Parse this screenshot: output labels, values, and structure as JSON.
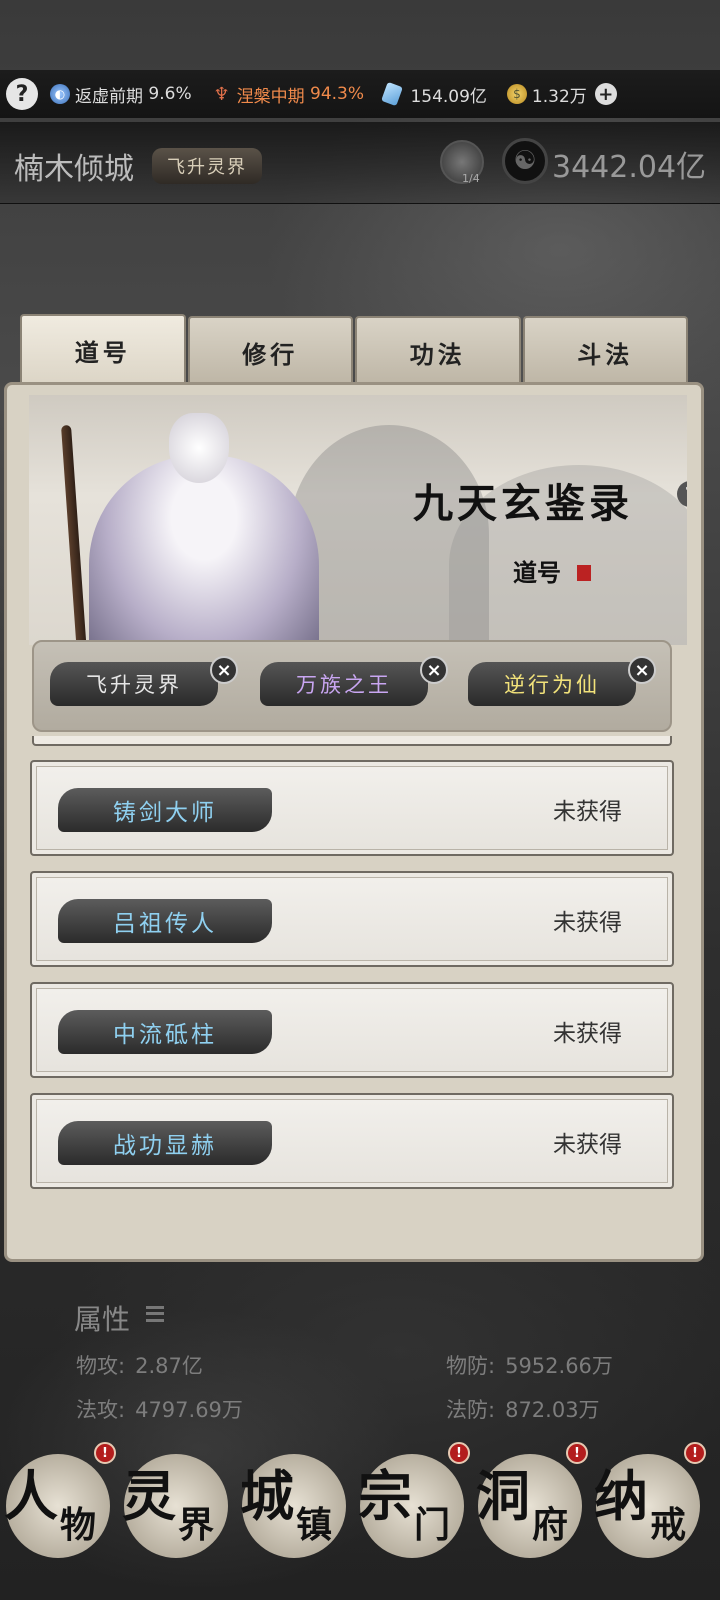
{
  "status_bar": {
    "help_label": "?",
    "realm": "返虚前期",
    "realm_pct": "9.6%",
    "nirvana": "涅槃中期",
    "nirvana_pct": "94.3%",
    "crystals": "154.09亿",
    "coins": "1.32万",
    "plus_label": "+"
  },
  "city": {
    "name": "楠木倾城",
    "title_tag": "飞升灵界",
    "avatar_count": "1/4",
    "spirit_value": "3442.04亿"
  },
  "tabs": [
    {
      "label": "道号",
      "active": true
    },
    {
      "label": "修行",
      "active": false
    },
    {
      "label": "功法",
      "active": false
    },
    {
      "label": "斗法",
      "active": false
    }
  ],
  "banner": {
    "title": "九天玄鉴录",
    "help_label": "?",
    "subtitle": "道号"
  },
  "equipped_titles": [
    {
      "label": "飞升灵界",
      "color": "#e6e6e6"
    },
    {
      "label": "万族之王",
      "color": "#c9a6f2"
    },
    {
      "label": "逆行为仙",
      "color": "#f2e27a"
    }
  ],
  "close_label": "×",
  "title_list": [
    {
      "name": "铸剑大师",
      "status": "未获得"
    },
    {
      "name": "吕祖传人",
      "status": "未获得"
    },
    {
      "name": "中流砥柱",
      "status": "未获得"
    },
    {
      "name": "战功显赫",
      "status": "未获得"
    }
  ],
  "attributes": {
    "title": "属性",
    "phys_atk_label": "物攻:",
    "phys_atk": "2.87亿",
    "phys_def_label": "物防:",
    "phys_def": "5952.66万",
    "mag_atk_label": "法攻:",
    "mag_atk": "4797.69万",
    "mag_def_label": "法防:",
    "mag_def": "872.03万"
  },
  "bottom_nav": [
    {
      "big": "人",
      "small": "物",
      "badge": "!"
    },
    {
      "big": "灵",
      "small": "界",
      "badge": ""
    },
    {
      "big": "城",
      "small": "镇",
      "badge": ""
    },
    {
      "big": "宗",
      "small": "门",
      "badge": "!"
    },
    {
      "big": "洞",
      "small": "府",
      "badge": "!"
    },
    {
      "big": "纳",
      "small": "戒",
      "badge": "!"
    }
  ]
}
